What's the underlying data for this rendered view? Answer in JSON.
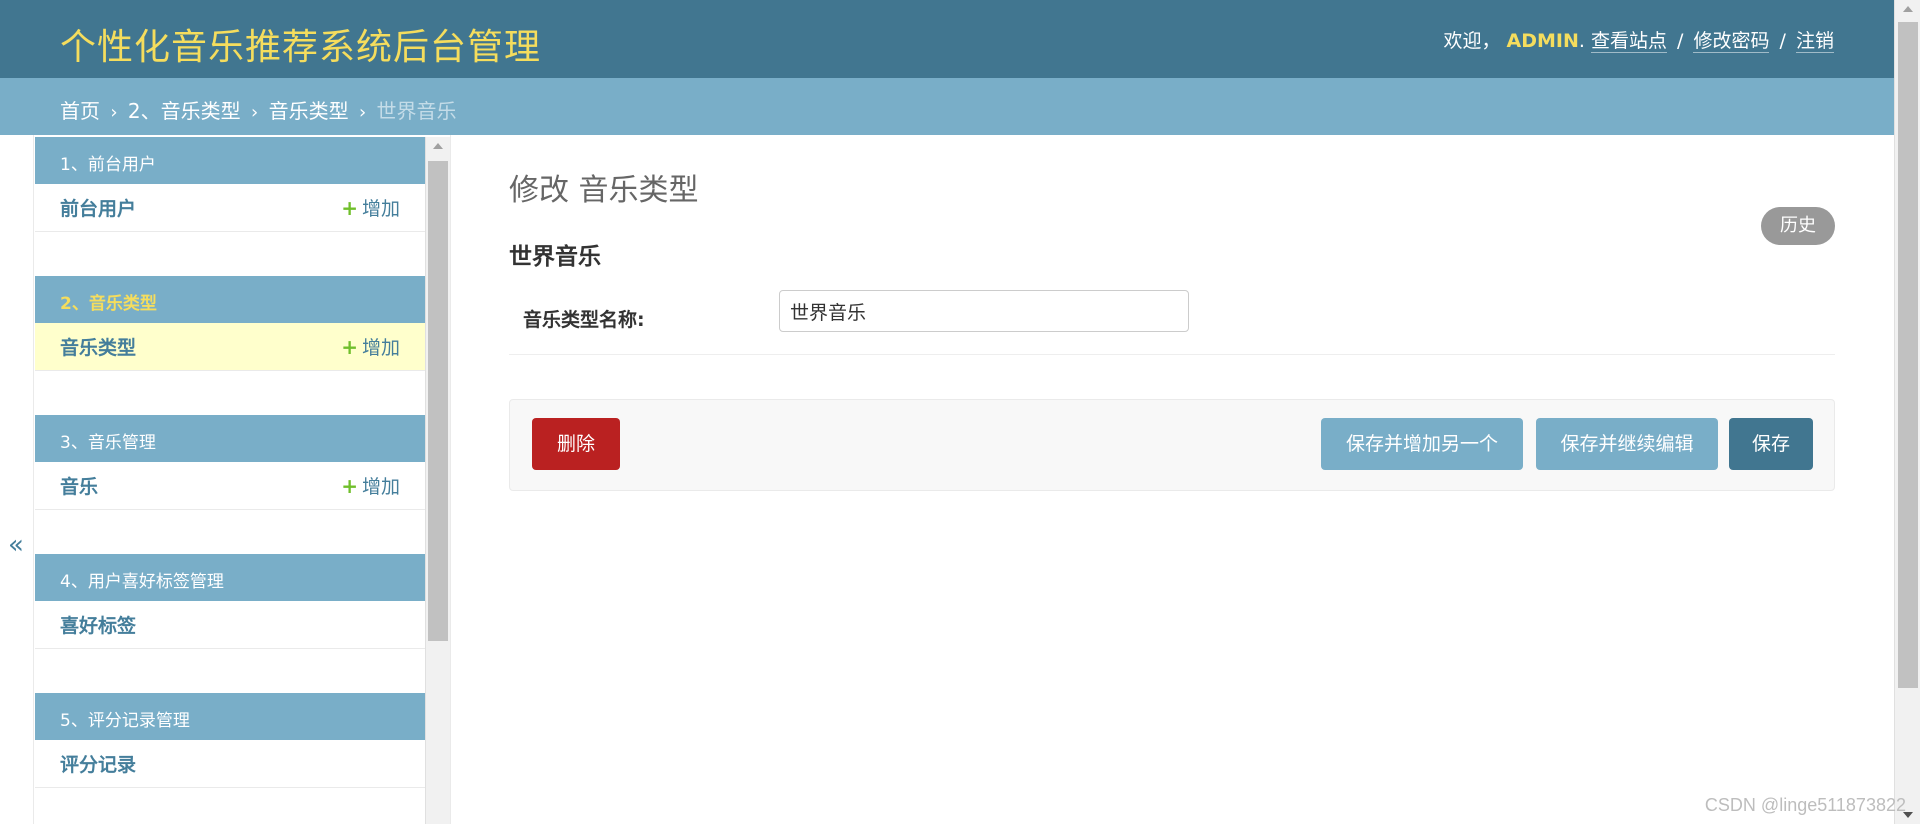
{
  "header": {
    "brand": "个性化音乐推荐系统后台管理",
    "welcome": "欢迎，",
    "username": "ADMIN",
    "username_suffix": ".",
    "links": [
      "查看站点",
      "修改密码",
      "注销"
    ],
    "separator": "/"
  },
  "breadcrumbs": {
    "items": [
      "首页",
      "2、音乐类型",
      "音乐类型"
    ],
    "current": "世界音乐",
    "arrow": "›"
  },
  "nav_toggle": {
    "glyph": "«"
  },
  "sidebar": {
    "modules": [
      {
        "caption": "1、前台用户",
        "rows": [
          {
            "label": "前台用户",
            "add": "增加"
          }
        ]
      },
      {
        "caption": "2、音乐类型",
        "rows": [
          {
            "label": "音乐类型",
            "add": "增加"
          }
        ]
      },
      {
        "caption": "3、音乐管理",
        "rows": [
          {
            "label": "音乐",
            "add": "增加"
          }
        ]
      },
      {
        "caption": "4、用户喜好标签管理",
        "rows": [
          {
            "label": "喜好标签"
          }
        ]
      },
      {
        "caption": "5、评分记录管理",
        "rows": [
          {
            "label": "评分记录"
          }
        ]
      }
    ],
    "add_icon": "+"
  },
  "main": {
    "title": "修改 音乐类型",
    "history_label": "历史",
    "object_title": "世界音乐",
    "field_label": "音乐类型名称:",
    "field_value": "世界音乐",
    "delete_label": "删除",
    "save_add_label": "保存并增加另一个",
    "save_continue_label": "保存并继续编辑",
    "save_label": "保存"
  },
  "watermark": "CSDN @linge511873822",
  "colors": {
    "header_bg": "#417690",
    "brand": "#f5dd5d",
    "breadcrumb_bg": "#79aec8",
    "current_row_bg": "#ffffcc",
    "delete": "#ba2121",
    "add_plus": "#70bf2b"
  }
}
